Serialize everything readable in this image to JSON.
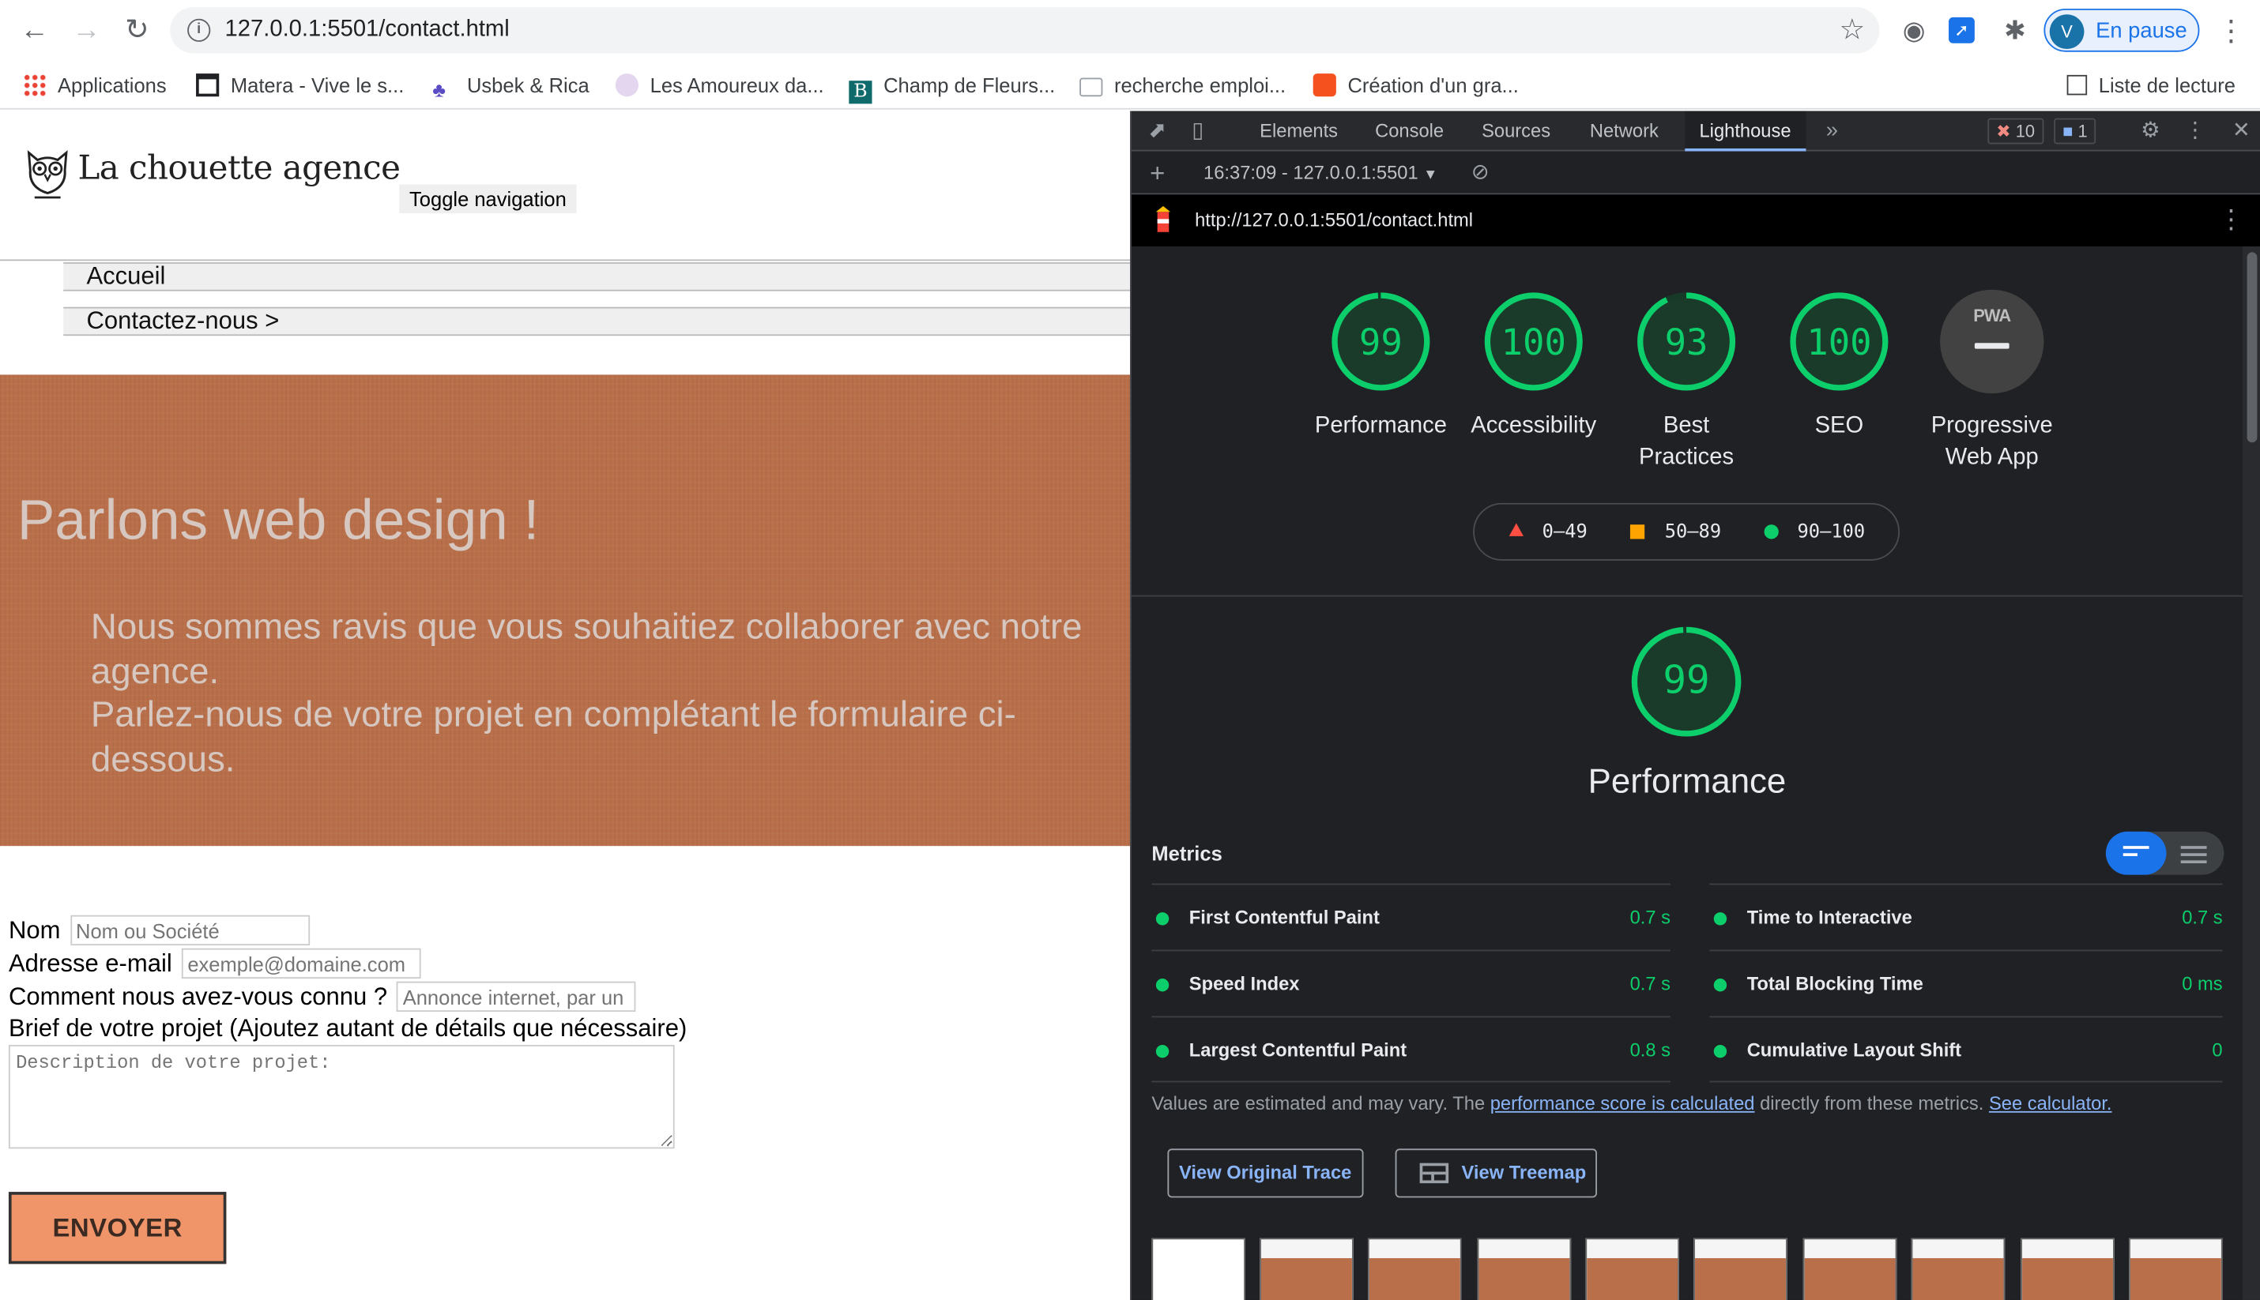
{
  "browser": {
    "url": "127.0.0.1:5501/contact.html",
    "profile_initial": "V",
    "profile_label": "En pause",
    "bookmarks": [
      "Applications",
      "Matera - Vive le s...",
      "Usbek & Rica",
      "Les Amoureux da...",
      "Champ de Fleurs...",
      "recherche emploi...",
      "Création d'un gra..."
    ],
    "reading_list": "Liste de lecture"
  },
  "site": {
    "logo_text": "La chouette agence",
    "toggle_nav": "Toggle navigation",
    "nav": [
      "Accueil",
      "Contactez-nous >"
    ],
    "hero_title": "Parlons web design !",
    "hero_text_1": "Nous sommes ravis que vous souhaitiez collaborer avec notre agence.",
    "hero_text_2": "Parlez-nous de votre projet en complétant le formulaire ci-dessous.",
    "form": {
      "name_label": "Nom",
      "name_placeholder": "Nom ou Société",
      "email_label": "Adresse e-mail",
      "email_placeholder": "exemple@domaine.com",
      "source_label": "Comment nous avez-vous connu ?",
      "source_placeholder": "Annonce internet, par un",
      "brief_label": "Brief de votre projet (Ajoutez autant de détails que nécessaire)",
      "brief_placeholder": "Description de votre projet:",
      "submit": "ENVOYER"
    }
  },
  "devtools": {
    "tabs": [
      "Elements",
      "Console",
      "Sources",
      "Network",
      "Lighthouse"
    ],
    "active_tab": "Lighthouse",
    "errors": "10",
    "messages": "1",
    "report_selector": "16:37:09 - 127.0.0.1:5501",
    "report_url": "http://127.0.0.1:5501/contact.html",
    "categories": [
      {
        "label": "Performance",
        "score": 99
      },
      {
        "label": "Accessibility",
        "score": 100
      },
      {
        "label": "Best Practices",
        "score": 93
      },
      {
        "label": "SEO",
        "score": 100
      }
    ],
    "pwa": {
      "label": "Progressive Web App",
      "badge": "PWA"
    },
    "legend": [
      "0–49",
      "50–89",
      "90–100"
    ],
    "legend_colors": {
      "fail": "#ff4e42",
      "average": "#ffa400",
      "pass": "#0cce6b"
    },
    "performance_score": 99,
    "performance_title": "Performance",
    "metrics_heading": "Metrics",
    "metrics": [
      {
        "label": "First Contentful Paint",
        "value": "0.7 s"
      },
      {
        "label": "Time to Interactive",
        "value": "0.7 s"
      },
      {
        "label": "Speed Index",
        "value": "0.7 s"
      },
      {
        "label": "Total Blocking Time",
        "value": "0 ms"
      },
      {
        "label": "Largest Contentful Paint",
        "value": "0.8 s"
      },
      {
        "label": "Cumulative Layout Shift",
        "value": "0"
      }
    ],
    "note_prefix": "Values are estimated and may vary. The ",
    "note_link1": "performance score is calculated",
    "note_mid": " directly from these metrics. ",
    "note_link2": "See calculator.",
    "btn_trace": "View Original Trace",
    "btn_treemap": "View Treemap"
  }
}
